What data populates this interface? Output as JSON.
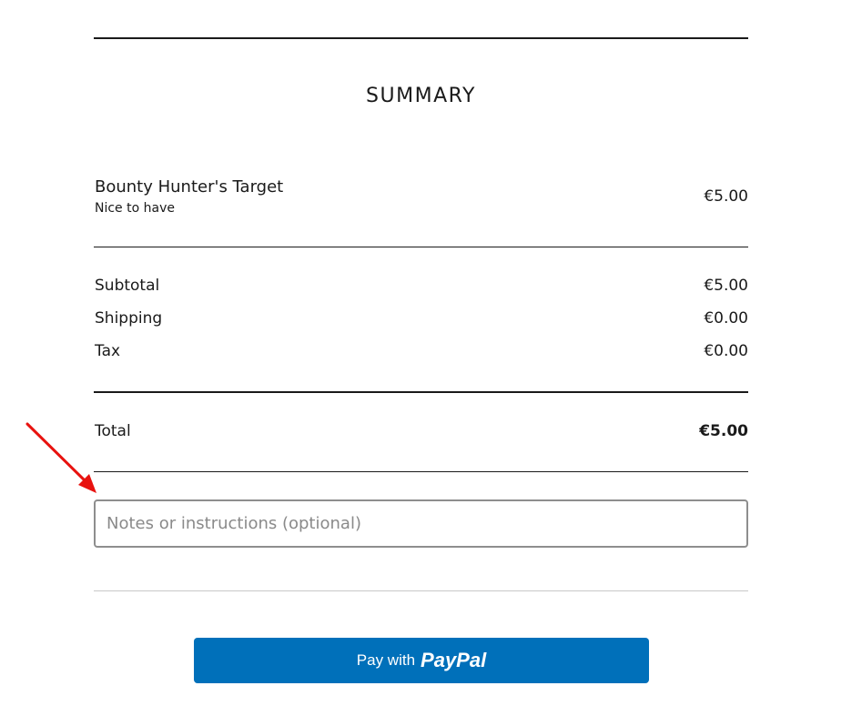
{
  "summary": {
    "title": "SUMMARY"
  },
  "item": {
    "name": "Bounty Hunter's Target",
    "subtitle": "Nice to have",
    "price": "€5.00"
  },
  "totals": {
    "subtotal_label": "Subtotal",
    "subtotal_value": "€5.00",
    "shipping_label": "Shipping",
    "shipping_value": "€0.00",
    "tax_label": "Tax",
    "tax_value": "€0.00",
    "total_label": "Total",
    "total_value": "€5.00"
  },
  "notes": {
    "placeholder": "Notes or instructions (optional)",
    "value": ""
  },
  "paypal": {
    "prefix": "Pay with",
    "brand": "PayPal",
    "color": "#0070ba"
  },
  "annotation": {
    "arrow_color": "#e8120f",
    "icon": "red-arrow-icon"
  }
}
